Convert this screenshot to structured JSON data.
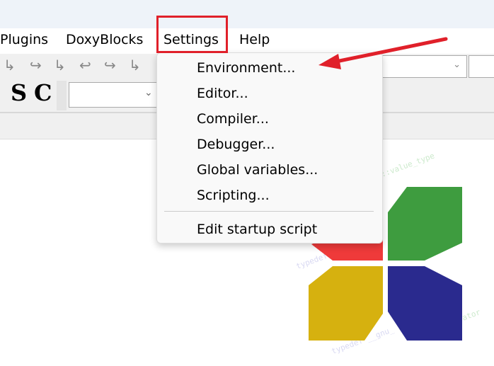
{
  "menubar": {
    "items": [
      "Plugins",
      "DoxyBlocks",
      "Settings",
      "Help"
    ]
  },
  "toolbar": {
    "s_label": "S",
    "c_label": "C"
  },
  "settings_menu": {
    "items": [
      "Environment...",
      "Editor...",
      "Compiler...",
      "Debugger...",
      "Global variables...",
      "Scripting..."
    ],
    "extra": "Edit startup script"
  },
  "colors": {
    "highlight": "#e0202a",
    "green": "#3e9c3f",
    "red": "#ef3a3a",
    "yellow": "#d6b10f",
    "blue": "#2a2a8e"
  }
}
